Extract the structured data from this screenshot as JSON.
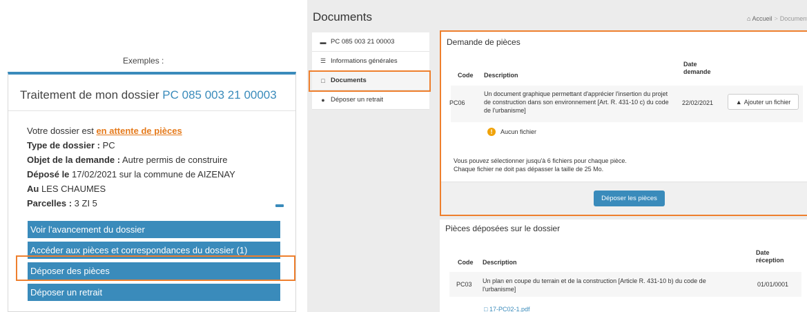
{
  "left": {
    "examples_label": "Exemples :",
    "card_title_prefix": "Traitement de mon dossier ",
    "card_title_number": "PC 085 003 21 00003",
    "status_prefix": "Votre dossier est ",
    "status_value": "en attente de pièces",
    "type_label": "Type de dossier :",
    "type_value": " PC",
    "objet_label": "Objet de la demande :",
    "objet_value": " Autre permis de construire",
    "depose_label": "Déposé le",
    "depose_value": " 17/02/2021 sur la commune de AIZENAY",
    "au_label": "Au",
    "au_value": " LES CHAUMES",
    "parcelles_label": "Parcelles :",
    "parcelles_value": " 3 ZI 5",
    "actions": [
      "Voir l'avancement du dossier",
      "Accéder aux pièces et correspondances du dossier (1)",
      "Déposer des pièces",
      "Déposer un retrait"
    ]
  },
  "right": {
    "page_title": "Documents",
    "breadcrumb": {
      "home": "Accueil",
      "current": "Documents"
    },
    "nav": [
      {
        "icon": "file-icon",
        "label": "PC 085 003 21 00003"
      },
      {
        "icon": "list-icon",
        "label": "Informations générales"
      },
      {
        "icon": "folder-icon",
        "label": "Documents"
      },
      {
        "icon": "comment-icon",
        "label": "Déposer un retrait"
      }
    ],
    "demande": {
      "title": "Demande de pièces",
      "col_code": "Code",
      "col_description": "Description",
      "col_date": "Date demande",
      "row": {
        "code": "PC06",
        "description": "Un document graphique permettant d'apprécier l'insertion du projet de construction dans son environnement [Art. R. 431-10 c) du code de l'urbanisme]",
        "date": "22/02/2021"
      },
      "upload_label": "Ajouter un fichier",
      "no_file": "Aucun fichier",
      "help_line1": "Vous pouvez sélectionner jusqu'à 6 fichiers pour chaque pièce.",
      "help_line2": "Chaque fichier ne doit pas dépasser la taille de 25 Mo.",
      "submit_label": "Déposer les pièces"
    },
    "deposees": {
      "title": "Pièces déposées sur le dossier",
      "col_code": "Code",
      "col_description": "Description",
      "col_date": "Date réception",
      "row": {
        "code": "PC03",
        "description": "Un plan en coupe du terrain et de la construction [Article R. 431-10 b) du code de l'urbanisme]",
        "date": "01/01/0001"
      },
      "file_name": "17-PC02-1.pdf"
    }
  },
  "colors": {
    "accent": "#3a8bbb",
    "highlight": "#ee7f2d",
    "status": "#e57a1b"
  }
}
